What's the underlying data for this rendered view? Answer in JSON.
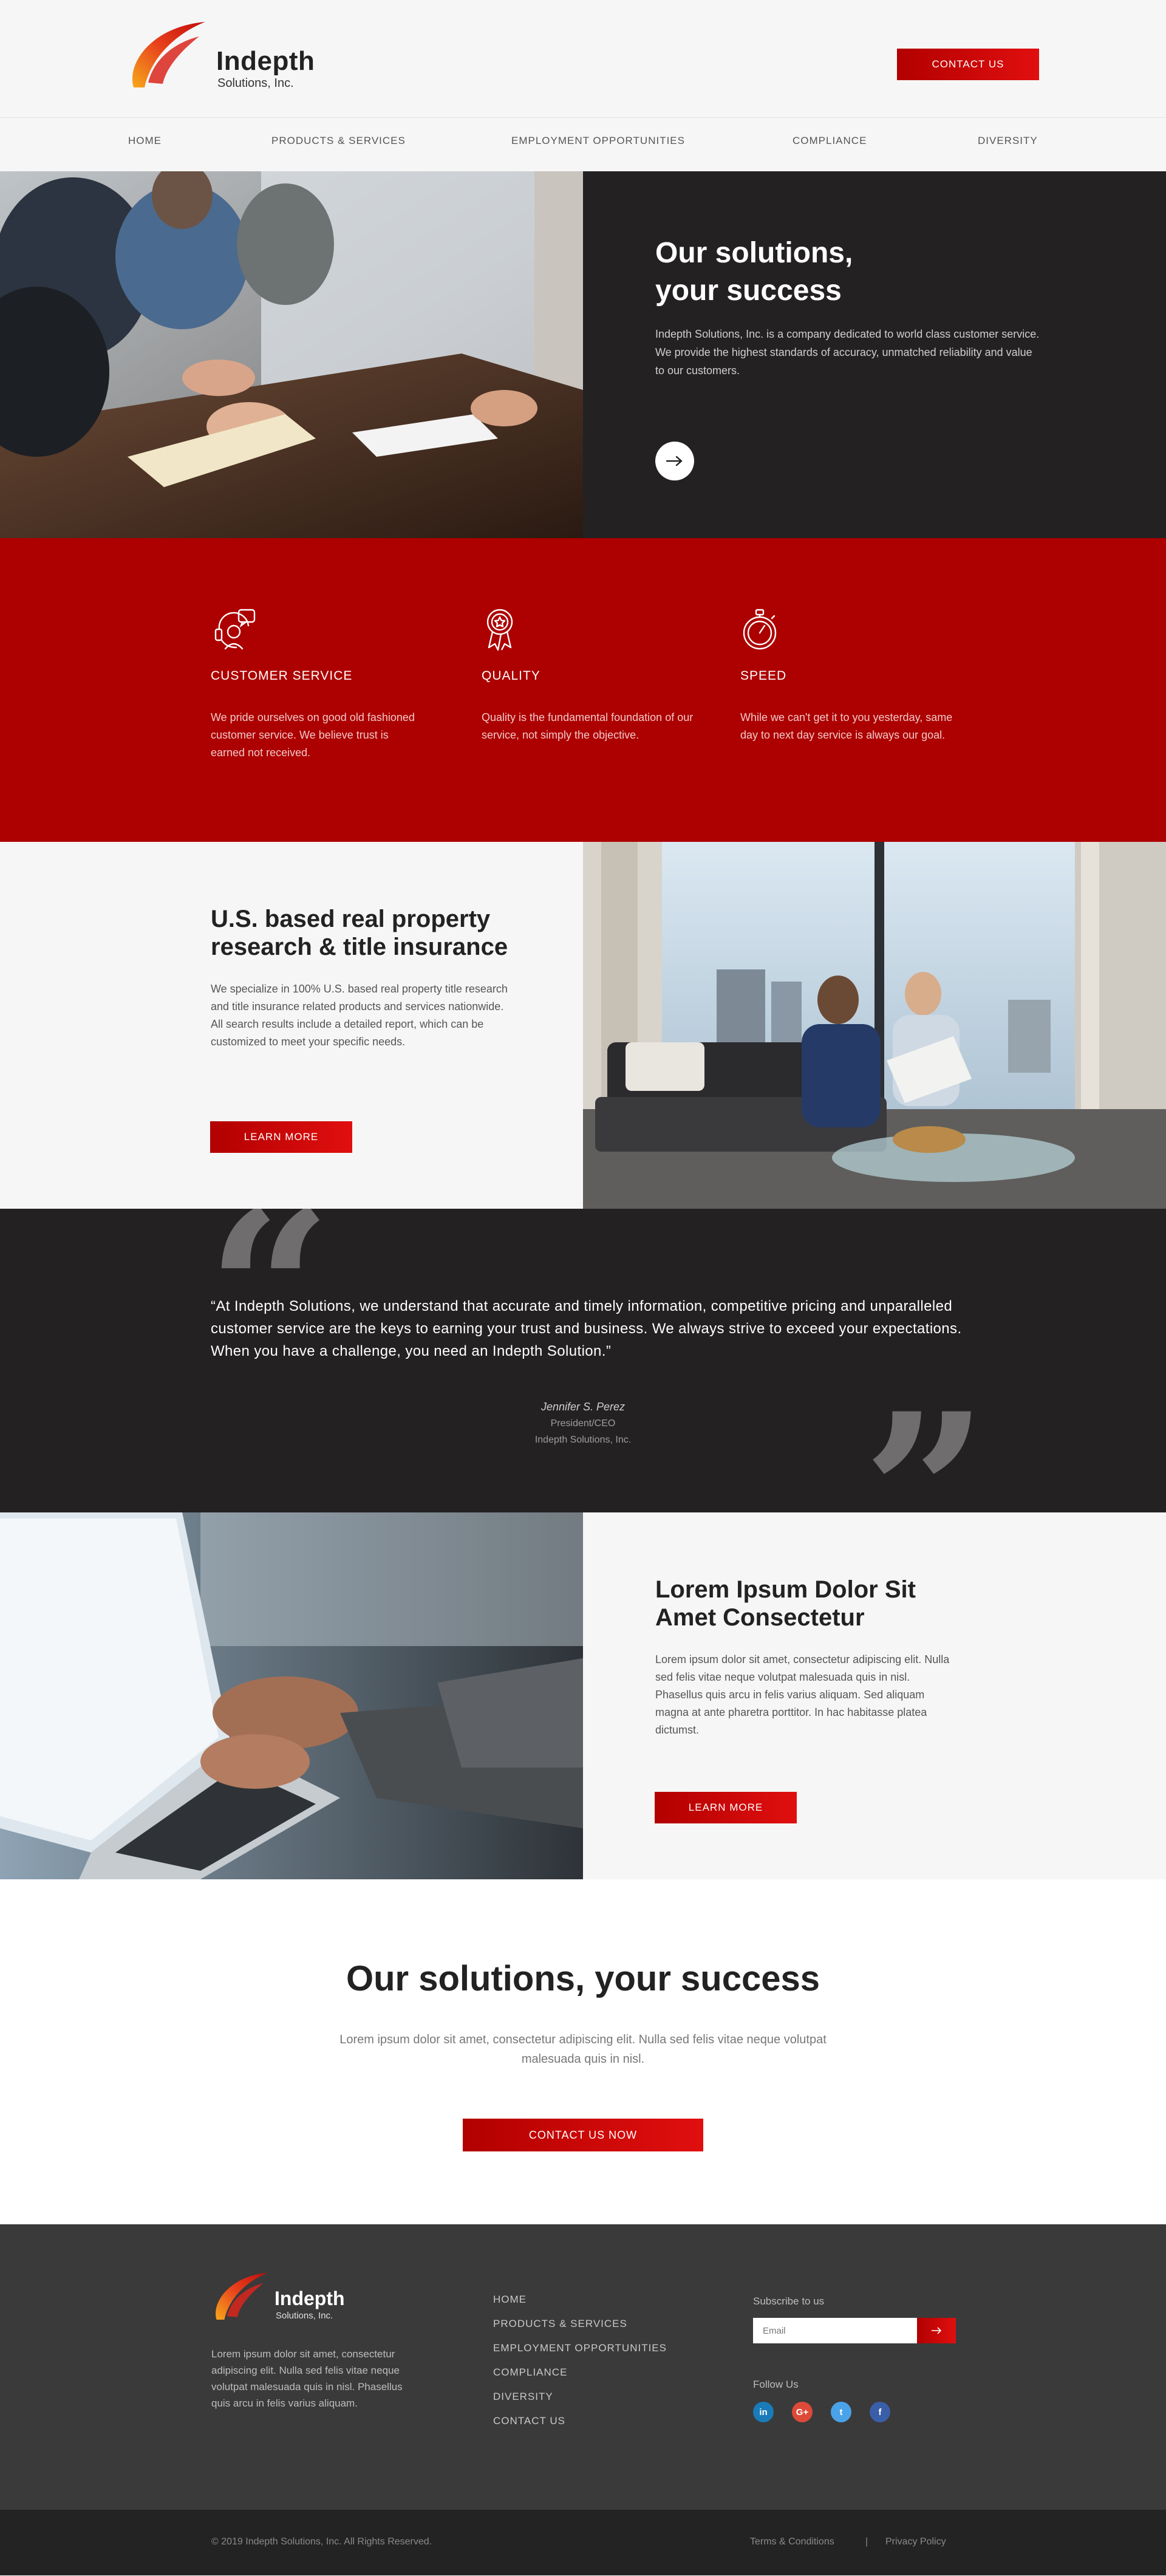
{
  "header": {
    "logo_name": "Indepth",
    "logo_sub": "Solutions, Inc.",
    "contact_label": "CONTACT US"
  },
  "nav": {
    "items": [
      {
        "label": "HOME"
      },
      {
        "label": "PRODUCTS & SERVICES"
      },
      {
        "label": "EMPLOYMENT OPPORTUNITIES"
      },
      {
        "label": "COMPLIANCE"
      },
      {
        "label": "DIVERSITY"
      }
    ]
  },
  "hero": {
    "title_line1": "Our solutions,",
    "title_line2": "your success",
    "body": "Indepth Solutions, Inc. is a company dedicated to world class customer service. We provide the highest standards of accuracy, unmatched reliability and value to our customers."
  },
  "features": [
    {
      "icon": "customer-service-icon",
      "title": "CUSTOMER SERVICE",
      "body": "We pride ourselves on good old fashioned customer service. We believe trust is earned not received."
    },
    {
      "icon": "quality-badge-icon",
      "title": "QUALITY",
      "body": "Quality is the fundamental foundation of our service, not simply the objective."
    },
    {
      "icon": "stopwatch-icon",
      "title": "SPEED",
      "body": "While we can't get it to you yesterday, same day to next day service is always our goal."
    }
  ],
  "property": {
    "title_line1": "U.S. based real property",
    "title_line2": "research & title insurance",
    "body": "We specialize in 100% U.S. based real property title research and title insurance related products and services nationwide. All search results include a detailed report, which can be customized to meet your specific needs.",
    "button": "LEARN MORE"
  },
  "testimonial": {
    "quote": "“At Indepth Solutions, we understand that accurate and timely information, competitive pricing and unparalleled customer service are the keys to earning your trust and business.  We always strive to exceed your expectations.  When you have a challenge, you need an Indepth Solution.”",
    "author": "Jennifer S. Perez",
    "role": "President/CEO",
    "company": "Indepth Solutions, Inc."
  },
  "lorem_section": {
    "title_line1": "Lorem Ipsum Dolor Sit",
    "title_line2": "Amet Consectetur",
    "body": "Lorem ipsum dolor sit amet, consectetur adipiscing elit. Nulla sed felis vitae neque volutpat malesuada quis in nisl. Phasellus quis arcu in felis varius aliquam. Sed aliquam magna at ante pharetra porttitor. In hac habitasse platea dictumst.",
    "button": "LEARN MORE"
  },
  "cta": {
    "title": "Our solutions, your success",
    "body": "Lorem ipsum dolor sit amet, consectetur adipiscing elit. Nulla sed felis vitae neque volutpat malesuada quis in nisl.",
    "button": "CONTACT US NOW"
  },
  "footer": {
    "logo_name": "Indepth",
    "logo_sub": "Solutions, Inc.",
    "about": "Lorem ipsum dolor sit amet, consectetur adipiscing elit. Nulla sed felis vitae neque volutpat malesuada quis in nisl. Phasellus quis arcu in felis varius aliquam.",
    "links": [
      {
        "label": "HOME"
      },
      {
        "label": "PRODUCTS & SERVICES"
      },
      {
        "label": "EMPLOYMENT OPPORTUNITIES"
      },
      {
        "label": "COMPLIANCE"
      },
      {
        "label": "DIVERSITY"
      },
      {
        "label": "CONTACT US"
      }
    ],
    "subscribe_label": "Subscribe to us",
    "email_placeholder": "Email",
    "follow_label": "Follow Us",
    "social": [
      {
        "icon": "linkedin-icon",
        "glyph": "in",
        "color": "#1a7bb9"
      },
      {
        "icon": "google-plus-icon",
        "glyph": "G+",
        "color": "#dc4a38"
      },
      {
        "icon": "twitter-icon",
        "glyph": "t",
        "color": "#4aa3e8"
      },
      {
        "icon": "facebook-icon",
        "glyph": "f",
        "color": "#3b5ea8"
      }
    ]
  },
  "bottom": {
    "copyright": "© 2019 Indepth Solutions, Inc. All Rights Reserved.",
    "terms": "Terms & Conditions",
    "separator": "|",
    "privacy": "Privacy Policy"
  },
  "colors": {
    "accent_red": "#ad0000",
    "dark": "#242122",
    "footer": "#3a3a3a"
  }
}
